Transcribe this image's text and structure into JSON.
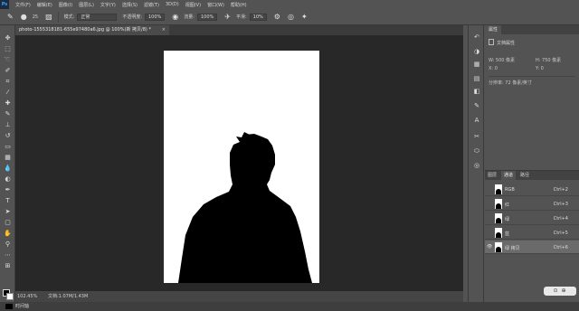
{
  "app": {
    "logo": "Ps"
  },
  "menu": [
    "文件(F)",
    "编辑(E)",
    "图像(I)",
    "图层(L)",
    "文字(Y)",
    "选择(S)",
    "滤镜(T)",
    "3D(D)",
    "视图(V)",
    "窗口(W)",
    "帮助(H)"
  ],
  "options": {
    "brush_size": "25",
    "mode_label": "模式:",
    "mode_value": "正常",
    "opacity_label": "不透明度:",
    "opacity_value": "100%",
    "flow_label": "流量:",
    "flow_value": "100%",
    "smoothing_label": "平滑:",
    "smoothing_value": "10%"
  },
  "document": {
    "tab_title": "photo-1555318181-655e97480a6.jpg @ 100%(新 拷贝/8) *",
    "close_glyph": "×"
  },
  "status": {
    "zoom": "102.45%",
    "doc_size": "文档:1.07M/1.43M"
  },
  "timeline": {
    "label": "时间轴"
  },
  "properties": {
    "tab": "属性",
    "header": "文档属性",
    "width": "W: 500 像素",
    "height": "H: 750 像素",
    "x": "X: 0",
    "y": "Y: 0",
    "resolution": "分辨率: 72 像素/英寸"
  },
  "channels_panel": {
    "tabs": [
      "图层",
      "通道",
      "路径"
    ],
    "active_tab": 1,
    "channels": [
      {
        "name": "RGB",
        "shortcut": "Ctrl+2",
        "visible": false,
        "selected": false
      },
      {
        "name": "红",
        "shortcut": "Ctrl+3",
        "visible": false,
        "selected": false
      },
      {
        "name": "绿",
        "shortcut": "Ctrl+4",
        "visible": false,
        "selected": false
      },
      {
        "name": "蓝",
        "shortcut": "Ctrl+5",
        "visible": false,
        "selected": false
      },
      {
        "name": "绿 拷贝",
        "shortcut": "Ctrl+6",
        "visible": true,
        "selected": true
      }
    ],
    "footer_button": "⊙ ⊕"
  },
  "colors": {
    "foreground": "#000000",
    "background": "#ffffff"
  }
}
